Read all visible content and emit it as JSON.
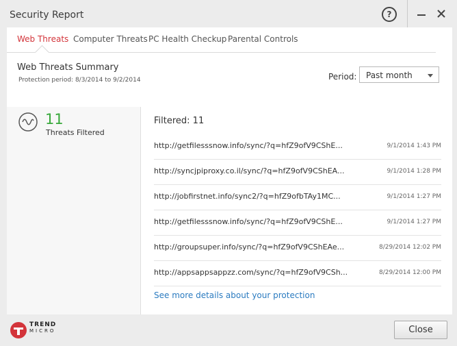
{
  "window": {
    "title": "Security Report",
    "help_glyph": "?"
  },
  "colors": {
    "accent": "#d3343a",
    "success": "#37a83a",
    "link": "#2b7bc0"
  },
  "tabs": [
    {
      "label": "Web Threats",
      "active": true
    },
    {
      "label": "Computer Threats",
      "active": false
    },
    {
      "label": "PC Health Checkup",
      "active": false
    },
    {
      "label": "Parental Controls",
      "active": false
    }
  ],
  "summary": {
    "title": "Web Threats Summary",
    "protection_period": "Protection period: 8/3/2014 to 9/2/2014",
    "period_label": "Period:",
    "period_value": "Past month"
  },
  "stats": {
    "count": "11",
    "label": "Threats Filtered",
    "icon": "wave-icon"
  },
  "list": {
    "header": "Filtered: 11",
    "items": [
      {
        "url": "http://getfilesssnow.info/sync/?q=hfZ9ofV9CShE...",
        "time": "9/1/2014 1:43 PM"
      },
      {
        "url": "http://syncjpiproxy.co.il/sync/?q=hfZ9ofV9CShEA...",
        "time": "9/1/2014 1:28 PM"
      },
      {
        "url": "http://jobfirstnet.info/sync2/?q=hfZ9ofbTAy1MC...",
        "time": "9/1/2014 1:27 PM"
      },
      {
        "url": "http://getfilesssnow.info/sync/?q=hfZ9ofV9CShE...",
        "time": "9/1/2014 1:27 PM"
      },
      {
        "url": "http://groupsuper.info/sync/?q=hfZ9ofV9CShEAe...",
        "time": "8/29/2014 12:02 PM"
      },
      {
        "url": "http://appsappsappzz.com/sync/?q=hfZ9ofV9CSh...",
        "time": "8/29/2014 12:00 PM"
      }
    ],
    "details_link": "See more details about your protection"
  },
  "footer": {
    "logo_line1": "TREND",
    "logo_line2": "MICRO",
    "close_label": "Close"
  }
}
